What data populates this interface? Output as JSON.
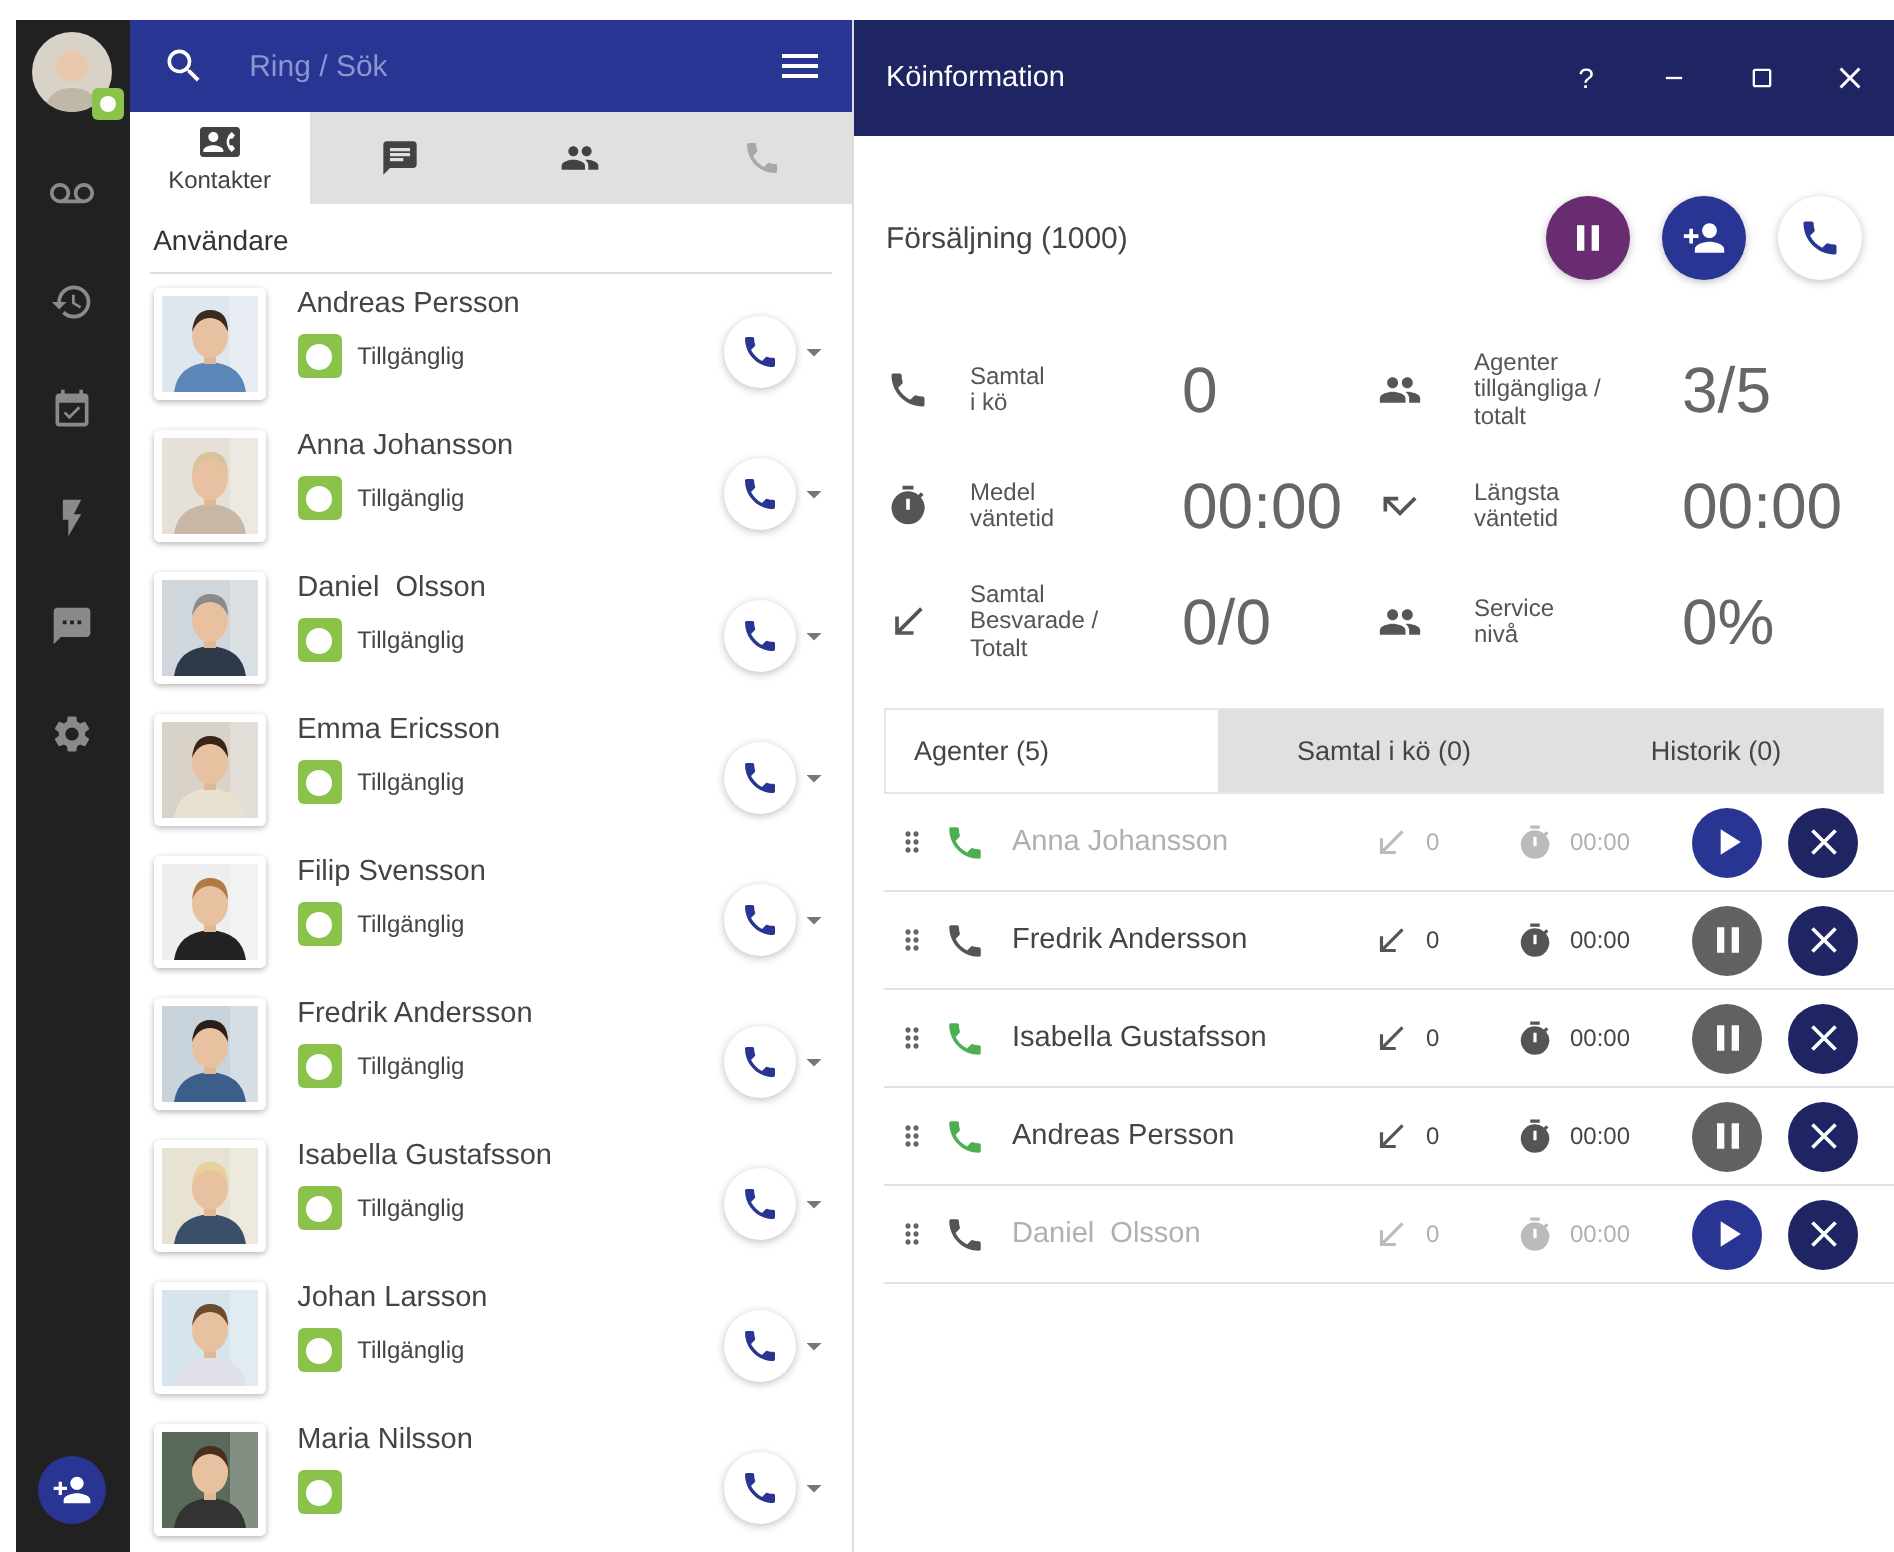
{
  "search": {
    "placeholder": "Ring / Sök"
  },
  "tabs": [
    {
      "label": "Kontakter",
      "selected": true,
      "disabled": false
    },
    {
      "selected": false,
      "disabled": false
    },
    {
      "selected": false,
      "disabled": false
    },
    {
      "selected": false,
      "disabled": true
    }
  ],
  "section_title": "Användare",
  "contacts": [
    {
      "name": "Andreas Persson",
      "status": "Tillgänglig",
      "color": "#8bc34a"
    },
    {
      "name": "Anna Johansson",
      "status": "Tillgänglig",
      "color": "#8bc34a"
    },
    {
      "name": "Daniel  Olsson",
      "status": "Tillgänglig",
      "color": "#8bc34a"
    },
    {
      "name": "Emma Ericsson",
      "status": "Tillgänglig",
      "color": "#8bc34a"
    },
    {
      "name": "Filip Svensson",
      "status": "Tillgänglig",
      "color": "#8bc34a"
    },
    {
      "name": "Fredrik Andersson",
      "status": "Tillgänglig",
      "color": "#8bc34a"
    },
    {
      "name": "Isabella Gustafsson",
      "status": "Tillgänglig",
      "color": "#8bc34a"
    },
    {
      "name": "Johan Larsson",
      "status": "Tillgänglig",
      "color": "#8bc34a"
    },
    {
      "name": "Maria Nilsson",
      "color": "#8bc34a"
    }
  ],
  "window": {
    "title": "Köinformation",
    "help": "?"
  },
  "queue": {
    "name": "Försäljning (1000)"
  },
  "stats": [
    {
      "label": "Samtal\ni kö",
      "value": "0"
    },
    {
      "label": "Agenter\ntillgängliga /\ntotalt",
      "value": "3/5"
    },
    {
      "label": "Medel\nväntetid",
      "value": "00:00"
    },
    {
      "label": "Längsta\nväntetid",
      "value": "00:00"
    },
    {
      "label": "Samtal\nBesvarade /\nTotalt",
      "value": "0/0"
    },
    {
      "label": "Service\nnivå",
      "value": "0%"
    }
  ],
  "agent_tabs": [
    {
      "label": "Agenter (5)",
      "selected": true
    },
    {
      "label": "Samtal i kö (0)",
      "selected": false
    },
    {
      "label": "Historik (0)",
      "selected": false
    }
  ],
  "agents": [
    {
      "name": "Anna Johansson",
      "answered": "0",
      "time": "00:00",
      "active": false,
      "color": "#4caf50"
    },
    {
      "name": "Fredrik Andersson",
      "answered": "0",
      "time": "00:00",
      "active": true,
      "color": "#555555"
    },
    {
      "name": "Isabella Gustafsson",
      "answered": "0",
      "time": "00:00",
      "active": true,
      "color": "#4caf50"
    },
    {
      "name": "Andreas Persson",
      "answered": "0",
      "time": "00:00",
      "active": true,
      "color": "#4caf50"
    },
    {
      "name": "Daniel  Olsson",
      "answered": "0",
      "time": "00:00",
      "active": false,
      "color": "#555555"
    }
  ]
}
